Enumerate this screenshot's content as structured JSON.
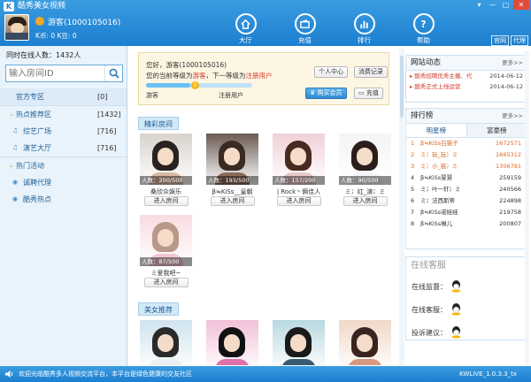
{
  "app": {
    "title": "酷秀美女视频",
    "logo": "K"
  },
  "window_controls": [
    "▾",
    "—",
    "▢",
    "✕"
  ],
  "user": {
    "name": "游客(1000105016)",
    "coins": "K币: 0   K豆: 0"
  },
  "nav": [
    {
      "label": "大厅",
      "icon": "home-icon"
    },
    {
      "label": "充值",
      "icon": "wallet-icon"
    },
    {
      "label": "排行",
      "icon": "bar-chart-icon"
    },
    {
      "label": "帮助",
      "icon": "help-icon"
    }
  ],
  "header_links": {
    "official": "官网",
    "agent": "代理"
  },
  "sidebar": {
    "online": "同时在线人数：1432人",
    "search_placeholder": "输入房间ID",
    "items": [
      {
        "label": "官方专区",
        "count": "[0]",
        "glyph": "",
        "type": "top"
      },
      {
        "label": "热点推荐区",
        "count": "[1432]",
        "glyph": "⌄",
        "type": "top"
      },
      {
        "label": "综艺广场",
        "count": "[716]",
        "glyph": "♫",
        "type": "sub"
      },
      {
        "label": "演艺大厅",
        "count": "[716]",
        "glyph": "♫",
        "type": "sub"
      },
      {
        "label": "热门活动",
        "count": "",
        "glyph": "⌄",
        "type": "top"
      },
      {
        "label": "诚聘代理",
        "count": "",
        "glyph": "◉",
        "type": "sub"
      },
      {
        "label": "酷秀热点",
        "count": "",
        "glyph": "◉",
        "type": "sub"
      }
    ]
  },
  "panel": {
    "hello": "您好，游客(1000105016)",
    "level_a": "您的当前等级为",
    "level_now": "游客",
    "level_b": "，下一等级为",
    "level_next": "注册用户",
    "progress": 0.42,
    "badge": "2",
    "label_left": "游客",
    "label_right": "注册用户",
    "btn_center": "个人中心",
    "btn_records": "消费记录",
    "btn_vip": "购买会员",
    "btn_recharge": "充值"
  },
  "sections": {
    "featured": "精彩房间",
    "recommended": "美女推荐"
  },
  "rooms": [
    {
      "count": "人数：200/500",
      "name": "桑欣众娱乐",
      "enter": "进入房间",
      "hair": "#2a2220",
      "body": "#d8b8a0",
      "bg": "#d8d2cc"
    },
    {
      "count": "人数：193/500",
      "name": "β≒KiSs__皇朝",
      "enter": "进入房间",
      "hair": "#3a2a22",
      "body": "#8c6a58",
      "bg": "#6a5a52"
    },
    {
      "count": "人数：157/200",
      "name": "| Rock丶俩佳人",
      "enter": "进入房间",
      "hair": "#4a2a20",
      "body": "#e8c8c8",
      "bg": "#f0d0d8"
    },
    {
      "count": "人数：90/500",
      "name": "ミ冫红_演冫ミ",
      "enter": "进入房间",
      "hair": "#2a1e1a",
      "body": "#f5f5f5",
      "bg": "#f4f4f4"
    },
    {
      "count": "人数：87/500",
      "name": "ミ爱我吧~",
      "enter": "进入房间",
      "hair": "#b89888",
      "body": "#f0c8d0",
      "bg": "#f7dce2"
    }
  ],
  "recommended": [
    {
      "hair": "#2a2a2a",
      "bg": "#cfe3ee",
      "body": "#e8f0f4"
    },
    {
      "hair": "#111111",
      "bg": "#f2c0d8",
      "body": "#e070a8"
    },
    {
      "hair": "#1a1a1a",
      "bg": "#b8d8e0",
      "body": "#3a5a70"
    },
    {
      "hair": "#3a2420",
      "bg": "#f0d8c8",
      "body": "#d89880"
    }
  ],
  "news": {
    "title": "网站动态",
    "more": "更多>>",
    "items": [
      {
        "text": "酷秀招聘优秀主播、代",
        "date": "2014-06-12"
      },
      {
        "text": "酷秀正式上线运营",
        "date": "2014-06-12"
      }
    ]
  },
  "ranking": {
    "title": "排行榜",
    "more": "更多>>",
    "tabs": [
      "明星榜",
      "富豪榜"
    ],
    "rows": [
      {
        "no": "1",
        "name": "β≒KiSs白猫子",
        "score": "1672571",
        "top": true
      },
      {
        "no": "2",
        "name": "ミ冫玩_玩冫ミ",
        "score": "1665312",
        "top": true
      },
      {
        "no": "3",
        "name": "ミ冫小_猫冫ミ",
        "score": "1306791",
        "top": true
      },
      {
        "no": "4",
        "name": "β≒KiSs慧慧",
        "score": "259159",
        "top": false
      },
      {
        "no": "5",
        "name": "ミ冫叶一轩冫ミ",
        "score": "240566",
        "top": false
      },
      {
        "no": "6",
        "name": "ミ冫法西斯蒂",
        "score": "224898",
        "top": false
      },
      {
        "no": "7",
        "name": "β≒KiSs诺娃娃",
        "score": "219758",
        "top": false
      },
      {
        "no": "8",
        "name": "β≒KiSs琳儿",
        "score": "200807",
        "top": false
      }
    ]
  },
  "service": {
    "title": "在线客服",
    "rows": [
      "在线监督：",
      "在线客服：",
      "投诉建议："
    ]
  },
  "status": {
    "message": "欢迎光临酷秀多人视频交流平台，本平台是绿色健康的交友社区",
    "version": "KWLIVE_1.0.3.3_tx"
  }
}
